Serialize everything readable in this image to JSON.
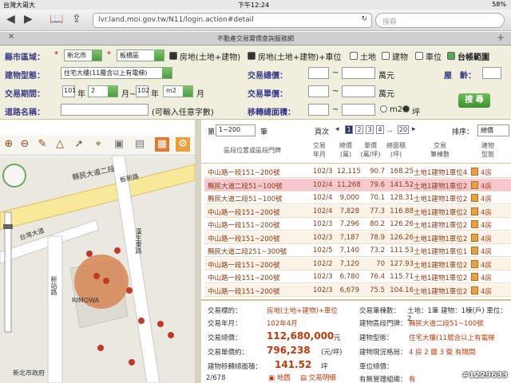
{
  "status": {
    "carrier": "台灣大哥大",
    "time": "下午12:24",
    "battery": "58%"
  },
  "browser": {
    "url": "lvr.land.moi.gov.tw/N11/login.action#detail",
    "search_placeholder": "搜尋",
    "tab_title": "不動產交易實價查詢服務網"
  },
  "form": {
    "city_label": "縣市區域：",
    "city": "新北市",
    "district": "板橋區",
    "chk1": "房地(土地+建物)",
    "chk2": "房地(土地+建物)+車位",
    "chk3": "土地",
    "chk4": "建物",
    "chk5": "車位",
    "chk6": "台帳範圍",
    "type_label": "建物型態：",
    "type_value": "住宅大樓(11層含以上有電梯)",
    "total_label": "交易總價：",
    "unit_wan": "萬元",
    "unit_label": "交易單價：",
    "unit_wan2": "萬元",
    "age_label": "屋　齡：",
    "period_label": "交易期間：",
    "y1": "101",
    "nian1": "年",
    "m1": "2",
    "yue1": "月~",
    "y2": "102",
    "nian2": "年",
    "m2": "m2",
    "yue2": "月",
    "area_label": "移轉總面積：",
    "ping": "坪",
    "road_label": "道路名稱：",
    "road_hint": "(可輸入任意字數)",
    "search_btn": "搜 尋"
  },
  "pager": {
    "per_page": "第",
    "range": "1~200",
    "bi": "筆",
    "page_label": "頁次",
    "pages": [
      "1",
      "2",
      "3",
      "4",
      ".."
    ],
    "last": "20",
    "sort_label": "排序：",
    "sort_value": "總價"
  },
  "table": {
    "headers": [
      "區段位置或區段門牌",
      "交易\n年月",
      "總價\n(萬)",
      "單價\n(萬/坪)",
      "總面積\n(坪)",
      "交易\n筆棟數",
      "建物\n型態"
    ],
    "rows": [
      [
        "中山路一段151~200號",
        "102/3",
        "12,115",
        "90.7",
        "168.25",
        "土地1建物1車位4",
        "4房"
      ],
      [
        "縣民大道二段51~100號",
        "102/4",
        "11,268",
        "79.6",
        "141.52",
        "土地1建物1車位2",
        "4房"
      ],
      [
        "縣民大道二段51~100號",
        "102/4",
        "9,000",
        "70.1",
        "128.31",
        "土地1建物1車位2",
        "4房"
      ],
      [
        "中山路一段151~200號",
        "102/4",
        "7,828",
        "77.3",
        "116.88",
        "土地1建物1車位2",
        "4房"
      ],
      [
        "中山路一段151~200號",
        "102/3",
        "7,296",
        "80.2",
        "126.26",
        "土地1建物1車位2",
        "4房"
      ],
      [
        "中山路一段151~200號",
        "102/3",
        "7,187",
        "78.9",
        "126.26",
        "土地1建物1車位2",
        "4房"
      ],
      [
        "縣民大道二段251~300號",
        "102/5",
        "7,140",
        "73.2",
        "111.53",
        "土地1建物1車位1",
        "4房"
      ],
      [
        "中山路一段151~200號",
        "102/2",
        "7,120",
        "70",
        "127.93",
        "土地1建物1車位2",
        "4房"
      ],
      [
        "中山路一段151~200號",
        "102/3",
        "6,780",
        "76.4",
        "115.71",
        "土地1建物1車位2",
        "4房"
      ],
      [
        "中山路一段151~200號",
        "102/3",
        "6,679",
        "75.5",
        "104.16",
        "土地1建物1車位2",
        "4房"
      ]
    ]
  },
  "detail": {
    "target_label": "交易標的：",
    "target": "房地(土地+建物)+車位",
    "ym_label": "交易年月：",
    "ym": "102年4月",
    "total_label": "交易總價：",
    "total": "112,680,000",
    "yuan": "元",
    "unitp_label": "交易單價約：",
    "unitp": "796,238",
    "unitp_unit": "(元/坪)",
    "area_label": "建物移轉總面積：",
    "area": "141.52",
    "ping": "坪",
    "counter": "2/678",
    "map_btn": "地圖",
    "detail_btn": "交易明細",
    "count_label": "交易筆棟數：",
    "count": "土地：1筆 建物：1棟(戶) 車位：2",
    "addr_label": "建物區段門牌：",
    "addr": "縣民大道二段51~100號",
    "btype_label": "建物型態：",
    "btype": "住宅大樓(11層含以上有電梯",
    "layout_label": "建物現況格局：",
    "layout": "4 房 2 廳 3 衛 有隔間",
    "park_label": "車位總價：",
    "park": "",
    "mgmt_label": "有無管理組織：",
    "mgmt": "有"
  },
  "map": {
    "street1": "縣民大道二段",
    "street2": "板新路",
    "street3": "台灣大道",
    "street4": "新站路",
    "street5": "漢生東路",
    "label1": "RIMOWA",
    "label2": "新北市政府"
  },
  "watermark": "#1229633",
  "colors": {
    "accent_green": "#4f9a3e",
    "row_text": "#8a3a10",
    "highlight": "#f7c9cf",
    "price": "#c0390b"
  }
}
